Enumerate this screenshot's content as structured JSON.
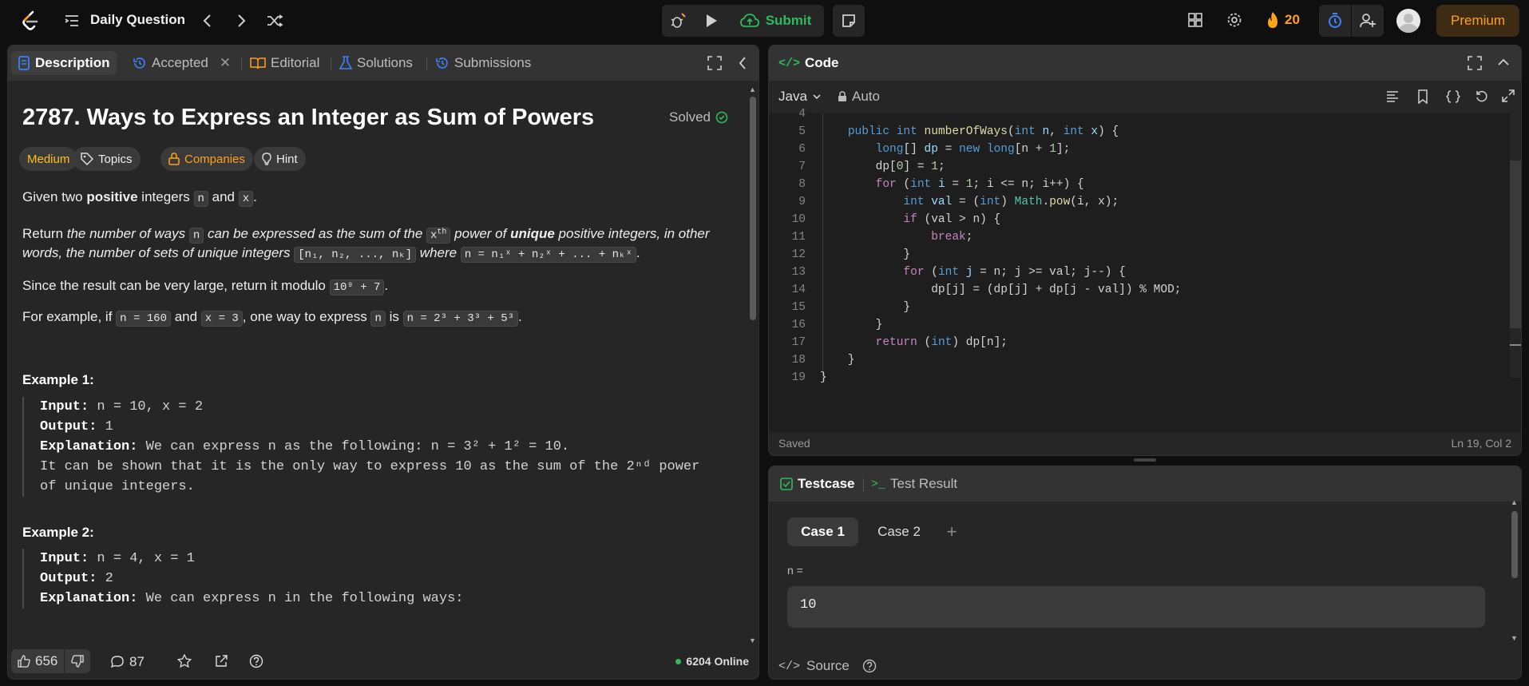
{
  "topbar": {
    "title": "Daily Question",
    "submit_label": "Submit",
    "streak_count": "20",
    "premium_label": "Premium"
  },
  "left_tabs": [
    {
      "label": "Description"
    },
    {
      "label": "Accepted"
    },
    {
      "label": "Editorial"
    },
    {
      "label": "Solutions"
    },
    {
      "label": "Submissions"
    }
  ],
  "problem": {
    "title": "2787. Ways to Express an Integer as Sum of Powers",
    "status": "Solved",
    "tags": [
      "Medium",
      "Topics",
      "Companies",
      "Hint"
    ],
    "p1": {
      "a": "Given two ",
      "b": "positive",
      "c": " integers ",
      "n": "n",
      "d": " and ",
      "x": "x",
      "e": "."
    },
    "p2": {
      "a": "Return ",
      "b": "the number of ways ",
      "n": "n",
      "c": " can be expressed as the sum of the ",
      "xth": "x",
      "th": "th",
      "d": " power of ",
      "e": "unique",
      "f": " positive integers, in other",
      "g": "words, the number of sets of unique integers ",
      "set": "[n₁, n₂, ..., nₖ]",
      "h": " where ",
      "eq": "n = n₁ˣ + n₂ˣ + ... + nₖˣ",
      "i": "."
    },
    "p3": {
      "a": "Since the result can be very large, return it modulo ",
      "mod": "10⁹ + 7",
      "b": "."
    },
    "p4": {
      "a": "For example, if ",
      "c1": "n = 160",
      "b": " and ",
      "c2": "x = 3",
      "c": ", one way to express ",
      "c3": "n",
      "d": " is ",
      "c4": "n = 2³ + 3³ + 5³",
      "e": "."
    }
  },
  "examples": [
    {
      "heading": "Example 1:",
      "input_label": "Input:",
      "input": " n = 10, x = 2",
      "output_label": "Output:",
      "output": " 1",
      "expl_label": "Explanation:",
      "expl": " We can express n as the following: n = 3² + 1² = 10.",
      "expl2": "It can be shown that it is the only way to express 10 as the sum of the 2ⁿᵈ power",
      "expl3": "of unique integers."
    },
    {
      "heading": "Example 2:",
      "input_label": "Input:",
      "input": " n = 4, x = 1",
      "output_label": "Output:",
      "output": " 2",
      "expl_label": "Explanation:",
      "expl": " We can express n in the following ways:"
    }
  ],
  "footer": {
    "likes": "656",
    "comments": "87",
    "online": "6204 Online"
  },
  "code_panel": {
    "title": "Code",
    "language": "Java",
    "mode": "Auto",
    "status": "Saved",
    "cursor": "Ln 19, Col 2",
    "line_numbers": [
      "4",
      "5",
      "6",
      "7",
      "8",
      "9",
      "10",
      "11",
      "12",
      "13",
      "14",
      "15",
      "16",
      "17",
      "18",
      "19"
    ]
  },
  "test_panel": {
    "tab_testcase": "Testcase",
    "tab_result": "Test Result",
    "cases": [
      "Case 1",
      "Case 2"
    ],
    "var_label": "n =",
    "var_value": "10",
    "source_label": "Source"
  },
  "colors": {
    "accent_orange": "#ffa116",
    "green": "#2cbb5d",
    "blue": "#3c83f6"
  }
}
